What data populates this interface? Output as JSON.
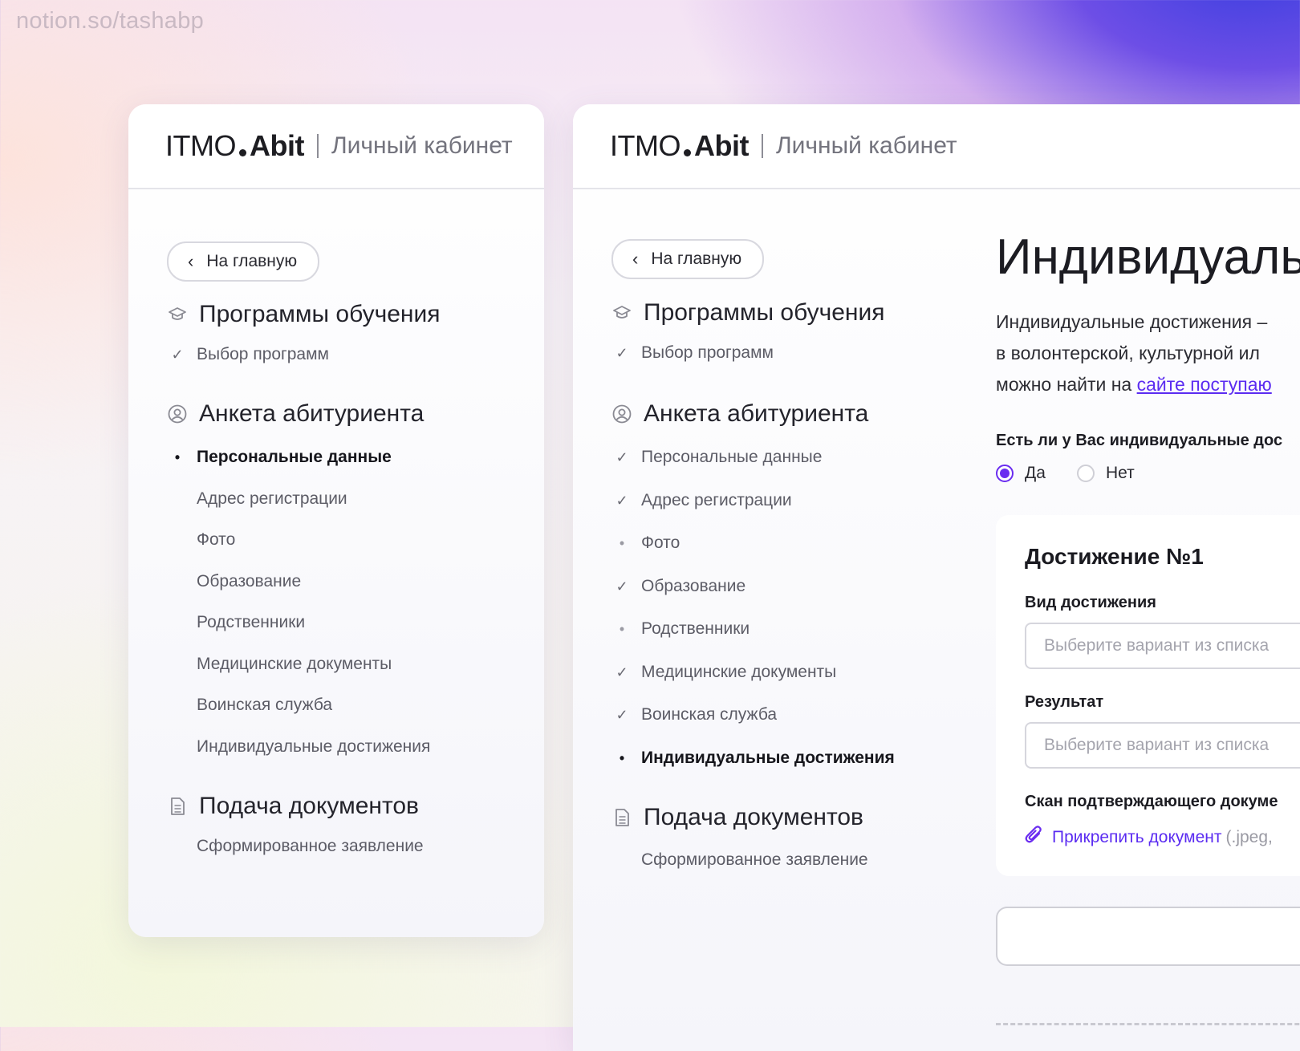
{
  "watermark": "notion.so/tashabp",
  "logo": {
    "left": "ITMO",
    "right": "Abit",
    "subtitle": "Личный кабинет"
  },
  "back_label": "На главную",
  "sections": {
    "programs": "Программы обучения",
    "form": "Анкета абитуриента",
    "submit": "Подача документов"
  },
  "nav": {
    "choose_programs": "Выбор программ",
    "personal": "Персональные данные",
    "address": "Адрес регистрации",
    "photo": "Фото",
    "education": "Образование",
    "relatives": "Родственники",
    "medical": "Медицинские документы",
    "military": "Воинская служба",
    "achievements": "Индивидуальные достижения",
    "application": "Сформированное заявление"
  },
  "icons": {
    "programs": "graduation-cap-icon",
    "form": "user-circle-icon",
    "submit": "document-icon",
    "done": "check-icon",
    "current": "bullet-icon"
  },
  "main": {
    "title": "Индивидуаль",
    "intro_lines": [
      "Индивидуальные достижения –",
      "в волонтерской, культурной ил",
      "можно найти на "
    ],
    "intro_link": "сайте поступаю",
    "question": "Есть ли у Вас индивидуальные дос",
    "radio_yes": "Да",
    "radio_no": "Нет",
    "selected": "Да",
    "achievement_title": "Достижение №1",
    "type_label": "Вид достижения",
    "type_placeholder": "Выберите вариант из списка",
    "result_label": "Результат",
    "result_placeholder": "Выберите вариант из списка",
    "scan_label": "Скан подтверждающего докуме",
    "attach_label": "Прикрепить документ",
    "attach_ext": "(.jpeg,"
  },
  "colors": {
    "accent": "#6a2cf0",
    "link": "#5b2cf1",
    "text": "#1c1c22",
    "muted": "#5c5c66"
  }
}
